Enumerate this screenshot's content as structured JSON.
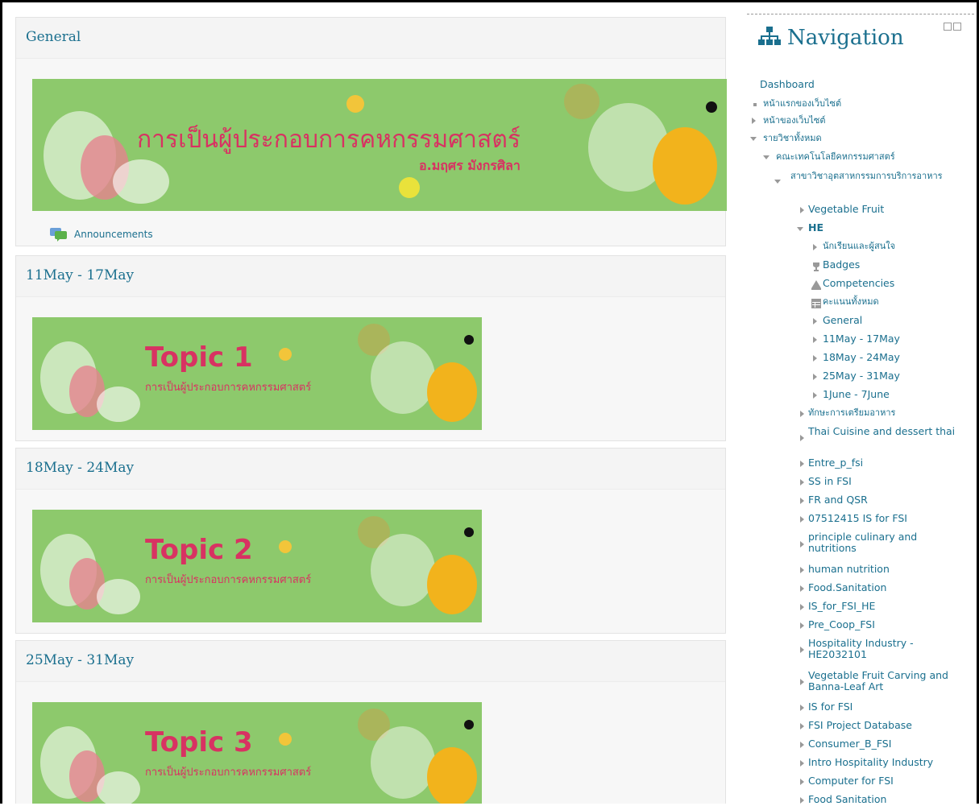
{
  "main": {
    "sections": [
      {
        "title": "General",
        "banner_title": "การเป็นผู้ประกอบการคหกรรมศาสตร์",
        "banner_author": "อ.มฤศร มังกรศิลา",
        "announcements_label": "Announcements"
      },
      {
        "title": "11May - 17May",
        "banner_topic": "Topic 1",
        "banner_sub": "การเป็นผู้ประกอบการคหกรรมศาสตร์"
      },
      {
        "title": "18May - 24May",
        "banner_topic": "Topic 2",
        "banner_sub": "การเป็นผู้ประกอบการคหกรรมศาสตร์"
      },
      {
        "title": "25May - 31May",
        "banner_topic": "Topic 3",
        "banner_sub": "การเป็นผู้ประกอบการคหกรรมศาสตร์"
      }
    ]
  },
  "nav": {
    "title": "Navigation",
    "items": [
      "Dashboard",
      "หน้าแรกของเว็บไซต์",
      "หน้าของเว็บไซต์",
      "รายวิชาทั้งหมด",
      "คณะเทคโนโลยีคหกรรมศาสตร์",
      "สาขาวิชาอุตสาหกรรมการบริการอาหาร",
      "Vegetable Fruit",
      "HE",
      "นักเรียนและผู้สนใจ",
      "Badges",
      "Competencies",
      "คะแนนทั้งหมด",
      "General",
      "11May - 17May",
      "18May - 24May",
      "25May - 31May",
      "1June - 7June",
      "ทักษะการเตรียมอาหาร",
      "Thai Cuisine and dessert thai",
      "Entre_p_fsi",
      "SS in FSI",
      "FR and QSR",
      "07512415 IS for FSI",
      "principle culinary and nutritions",
      "human nutrition",
      "Food.Sanitation",
      "IS_for_FSI_HE",
      "Pre_Coop_FSI",
      "Hospitality Industry - HE2032101",
      "Vegetable Fruit Carving and Banna-Leaf Art",
      "IS for FSI",
      "FSI Project Database",
      "Consumer_B_FSI",
      "Intro Hospitality Industry",
      "Computer for FSI",
      "Food Sanitation"
    ]
  },
  "colors": {
    "accent": "#1a6f8e",
    "banner_green": "#8dc96c",
    "banner_text": "#d83262"
  },
  "icons": [
    "forum-icon",
    "sitemap-icon",
    "trophy-icon",
    "competency-icon",
    "grades-icon",
    "chevron-right-icon",
    "chevron-down-icon"
  ]
}
